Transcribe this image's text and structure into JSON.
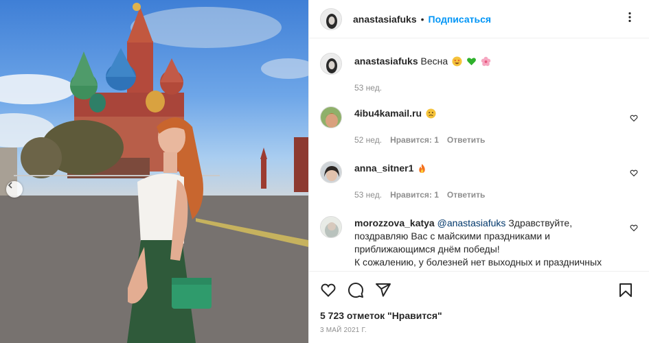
{
  "post": {
    "username": "anastasiafuks",
    "follow_label": "Подписаться",
    "caption_user": "anastasiafuks",
    "caption_text": "Весна",
    "caption_time": "53 нед.",
    "likes": "5 723 отметок \"Нравится\"",
    "date": "3 МАЙ 2021 Г."
  },
  "comments": [
    {
      "user": "4ibu4kamail.ru",
      "text": "",
      "time": "52 нед.",
      "likes": "Нравится: 1",
      "reply": "Ответить"
    },
    {
      "user": "anna_sitner1",
      "text": "",
      "time": "53 нед.",
      "likes": "Нравится: 1",
      "reply": "Ответить"
    },
    {
      "user": "morozzova_katya",
      "mention": "@anastasiafuks",
      "text": " Здравствуйте, поздравляю Вас с майскими праздниками и приближающимся днём победы!",
      "text2": "К сожалению, у болезней нет выходных и праздничных дней. Ваша помощь очень нужна маленькому Матвею"
    }
  ],
  "icons": [
    "more-icon",
    "heart-icon",
    "comment-icon",
    "share-icon",
    "bookmark-icon",
    "chevron-left-icon"
  ],
  "colors": {
    "link": "#0095f6",
    "mention": "#00376b",
    "meta": "#8e8e8e",
    "border": "#efefef"
  }
}
